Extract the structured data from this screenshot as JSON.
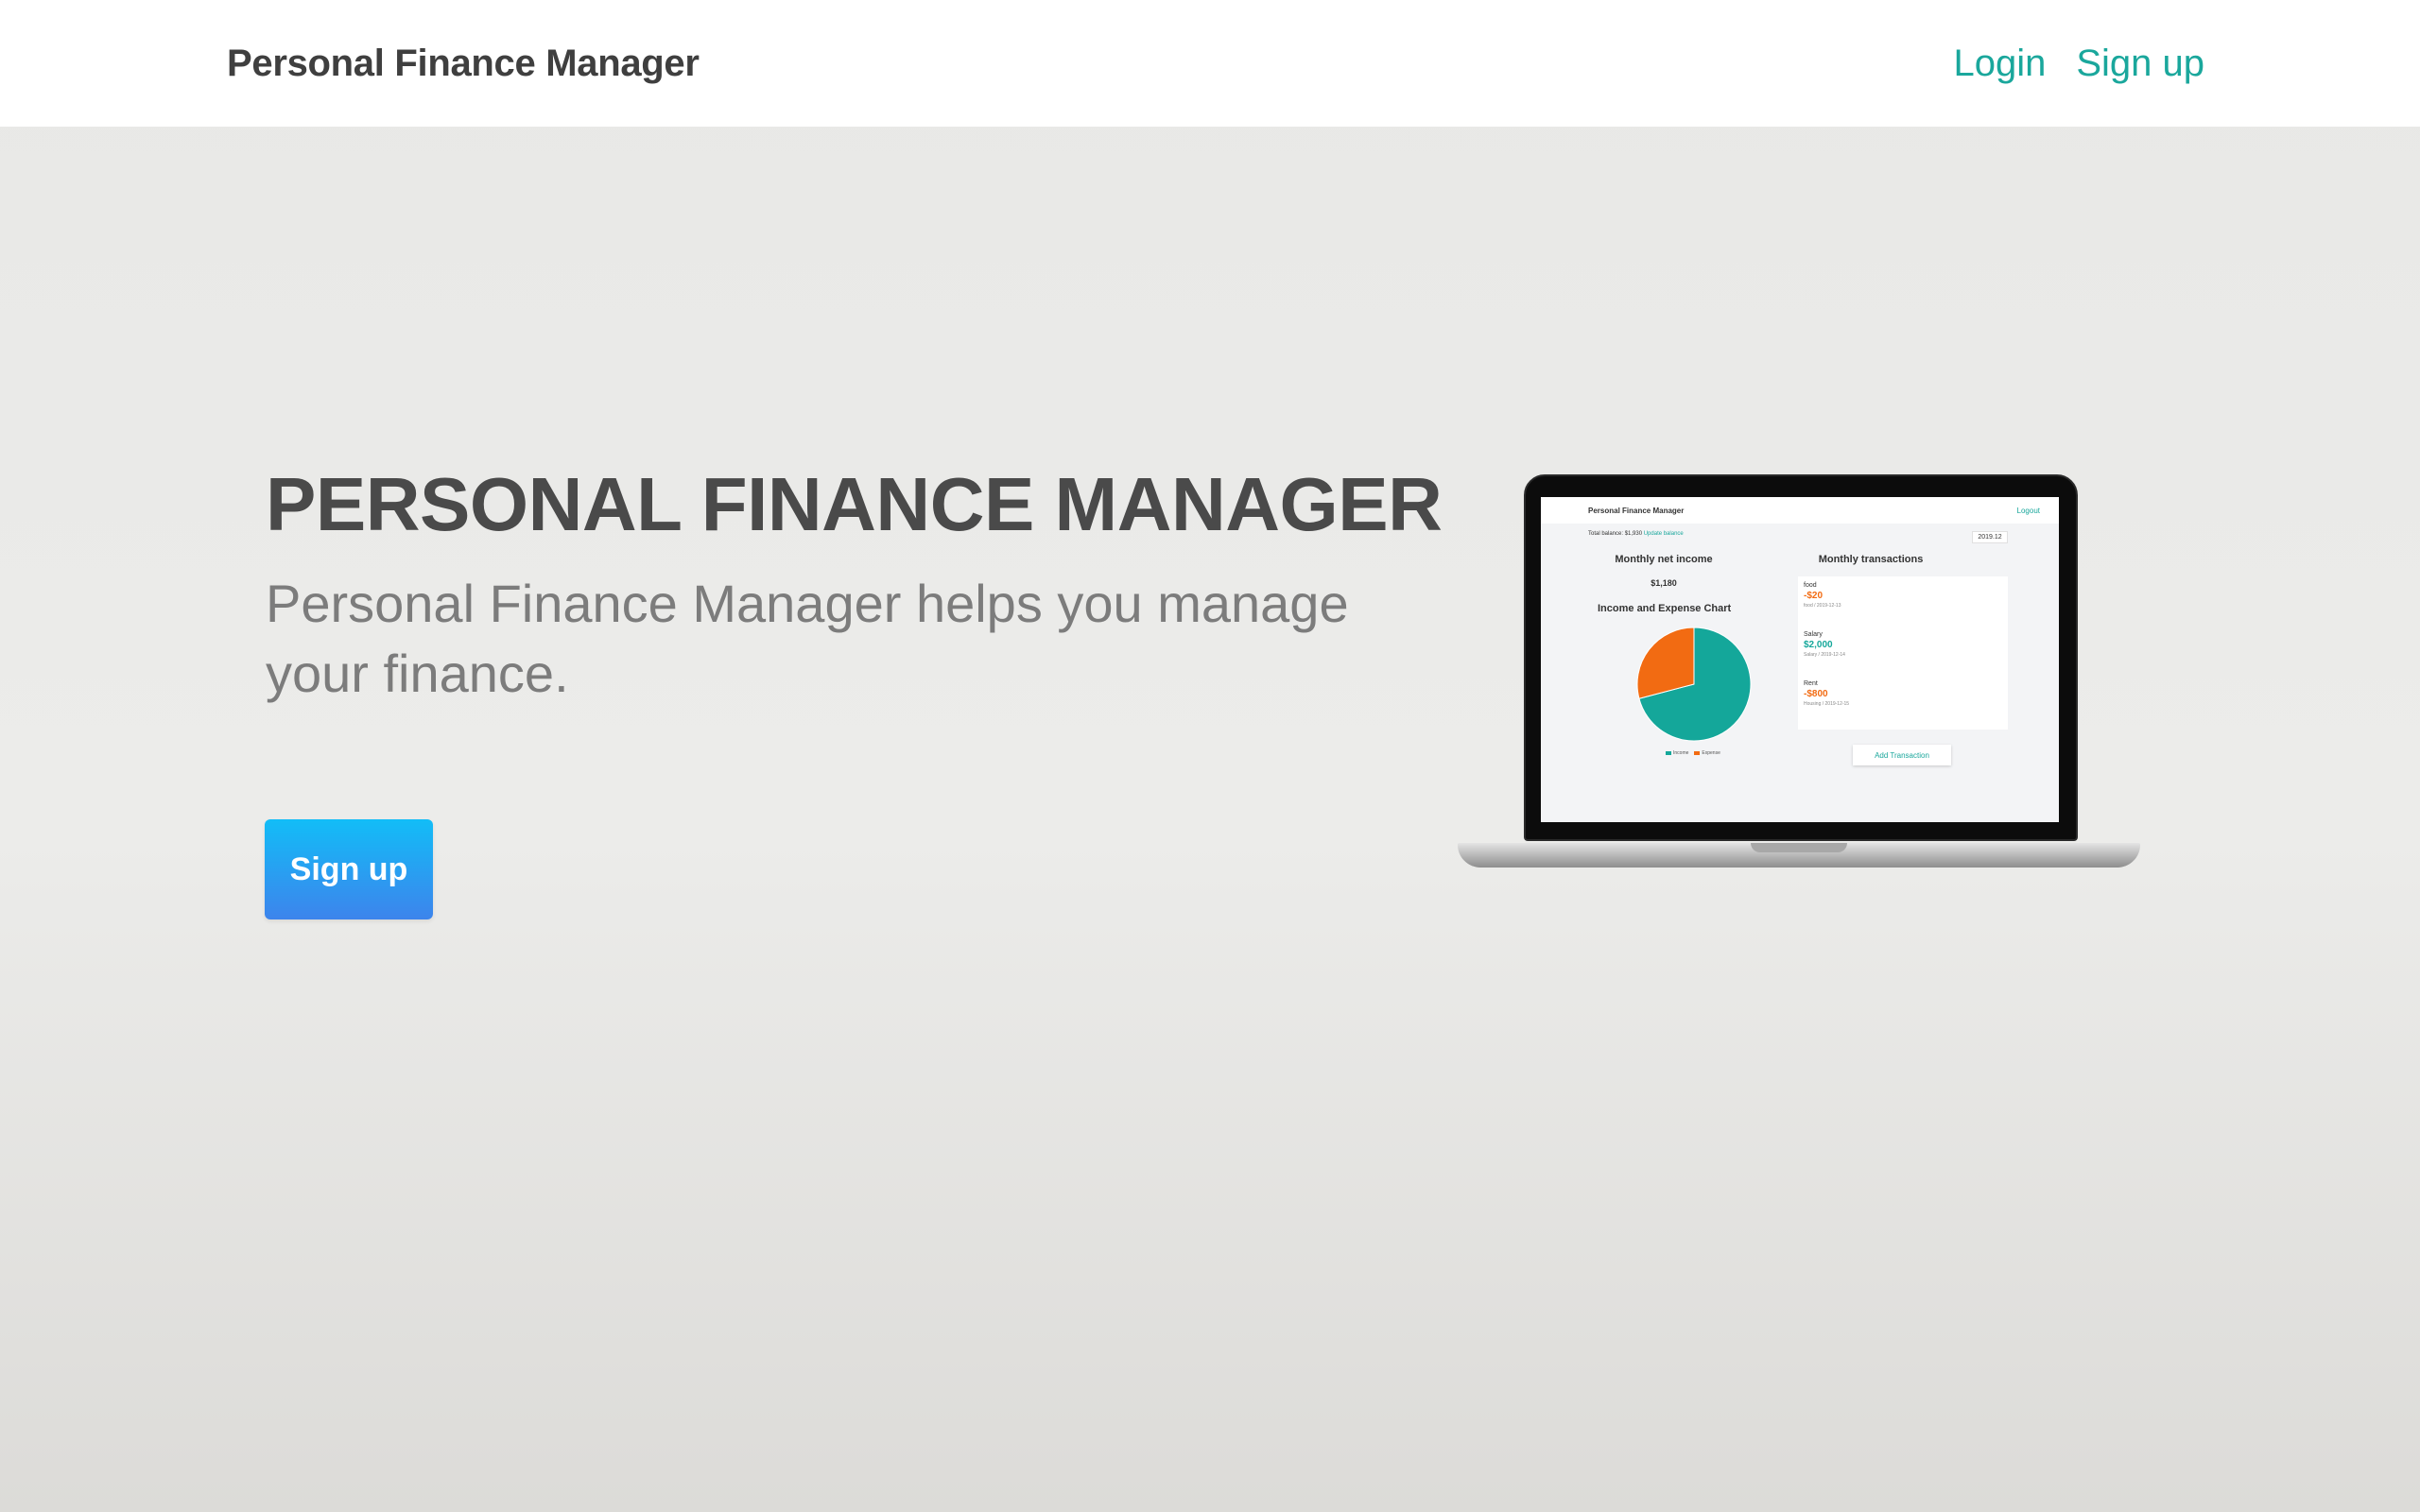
{
  "navbar": {
    "brand": "Personal Finance Manager",
    "login_label": "Login",
    "signup_label": "Sign up"
  },
  "hero": {
    "title": "PERSONAL FINANCE MANAGER",
    "subtitle": "Personal Finance Manager helps you manage your finance.",
    "cta_label": "Sign up"
  },
  "screenshot": {
    "brand": "Personal Finance Manager",
    "logout_label": "Logout",
    "balance_text": "Total balance: $1,930",
    "update_balance_label": "Update balance",
    "date": "2019.12",
    "income_title": "Monthly net income",
    "income_value": "$1,180",
    "chart_title": "Income and Expense Chart",
    "transactions_title": "Monthly transactions",
    "transactions": [
      {
        "category": "food",
        "amount": "-$20",
        "meta": "food / 2019-12-13",
        "type": "expense"
      },
      {
        "category": "Salary",
        "amount": "$2,000",
        "meta": "Salary / 2019-12-14",
        "type": "income"
      },
      {
        "category": "Rent",
        "amount": "-$800",
        "meta": "Housing / 2019-12-15",
        "type": "expense"
      }
    ],
    "add_transaction_label": "Add Transaction",
    "legend": [
      "Income",
      "Expense"
    ]
  },
  "colors": {
    "accent": "#1aa79c",
    "income": "#14a79a",
    "expense": "#f26b12",
    "cta_top": "#12bdf7",
    "cta_bottom": "#3d84ec"
  },
  "chart_data": {
    "type": "pie",
    "title": "Income and Expense Chart",
    "categories": [
      "Income",
      "Expense"
    ],
    "values": [
      2000,
      820
    ]
  }
}
